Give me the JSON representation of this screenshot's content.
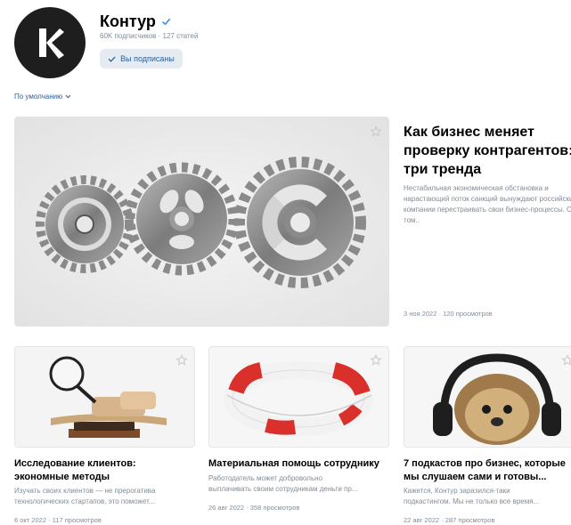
{
  "channel": {
    "name": "Контур",
    "subscribers": "60K подписчиков",
    "articles": "127 статей",
    "subscribe_label": "Вы подписаны"
  },
  "sort": {
    "label": "По умолчанию"
  },
  "featured": {
    "title_line1": "Как бизнес меняет",
    "title_line2": "проверку контрагентов:",
    "title_line3": "три тренда",
    "description": "Нестабильная экономическая обстановка и нарастающий поток санкций вынуждают российские компании перестраивать свои бизнес-процессы. О том..",
    "date": "3 ноя 2022",
    "views": "120 просмотров"
  },
  "articles": [
    {
      "title_line1": "Исследование клиентов:",
      "title_line2": "экономные методы",
      "desc_line1": "Изучать своих клиентов — не прерогатива",
      "desc_line2": "технологических стартапов, это поможет...",
      "date": "6 окт 2022",
      "views": "117 просмотров"
    },
    {
      "title_line1": "Материальная помощь сотруднику",
      "desc_line1": "Работодатель может добровольно",
      "desc_line2": "выплачивать своим сотрудникам деньги пр...",
      "date": "26 авг 2022",
      "views": "358 просмотров"
    },
    {
      "title_line1": "7 подкастов про бизнес, которые",
      "title_line2": "мы слушаем сами и готовы...",
      "desc_line1": "Кажется, Контур заразился-таки",
      "desc_line2": "подкастингом. Мы не только все время...",
      "date": "22 авг 2022",
      "views": "287 просмотров"
    }
  ],
  "colors": {
    "accent": "#2c5f99",
    "muted": "#818c99",
    "button_bg": "#e5ebf1",
    "logo_bg": "#1e1e1e"
  }
}
